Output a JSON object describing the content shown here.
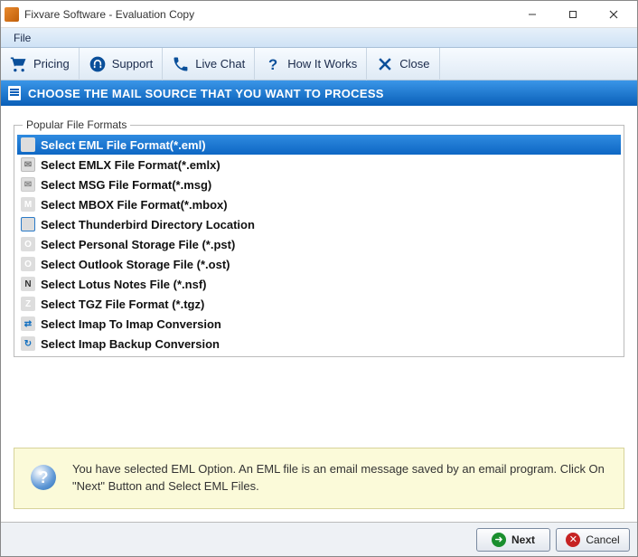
{
  "window": {
    "title": "Fixvare Software - Evaluation Copy"
  },
  "menu": {
    "items": [
      "File"
    ]
  },
  "toolbar": {
    "pricing": "Pricing",
    "support": "Support",
    "livechat": "Live Chat",
    "howitworks": "How It Works",
    "close": "Close"
  },
  "section": {
    "header": "CHOOSE THE MAIL SOURCE THAT YOU WANT TO PROCESS"
  },
  "formats": {
    "legend": "Popular File Formats",
    "items": [
      {
        "label": "Select EML File Format(*.eml)",
        "icon": "eml",
        "selected": true
      },
      {
        "label": "Select EMLX File Format(*.emlx)",
        "icon": "emlx",
        "selected": false
      },
      {
        "label": "Select MSG File Format(*.msg)",
        "icon": "msg",
        "selected": false
      },
      {
        "label": "Select MBOX File Format(*.mbox)",
        "icon": "mbox",
        "selected": false
      },
      {
        "label": "Select Thunderbird Directory Location",
        "icon": "tb",
        "selected": false
      },
      {
        "label": "Select Personal Storage File (*.pst)",
        "icon": "pst",
        "selected": false
      },
      {
        "label": "Select Outlook Storage File (*.ost)",
        "icon": "ost",
        "selected": false
      },
      {
        "label": "Select Lotus Notes File (*.nsf)",
        "icon": "nsf",
        "selected": false
      },
      {
        "label": "Select TGZ File Format (*.tgz)",
        "icon": "tgz",
        "selected": false
      },
      {
        "label": "Select Imap To Imap Conversion",
        "icon": "imap",
        "selected": false
      },
      {
        "label": "Select Imap Backup Conversion",
        "icon": "bak",
        "selected": false
      }
    ]
  },
  "info": {
    "text": "You have selected EML Option. An EML file is an email message saved by an email program. Click On \"Next\" Button and Select EML Files."
  },
  "footer": {
    "next": "Next",
    "cancel": "Cancel"
  }
}
